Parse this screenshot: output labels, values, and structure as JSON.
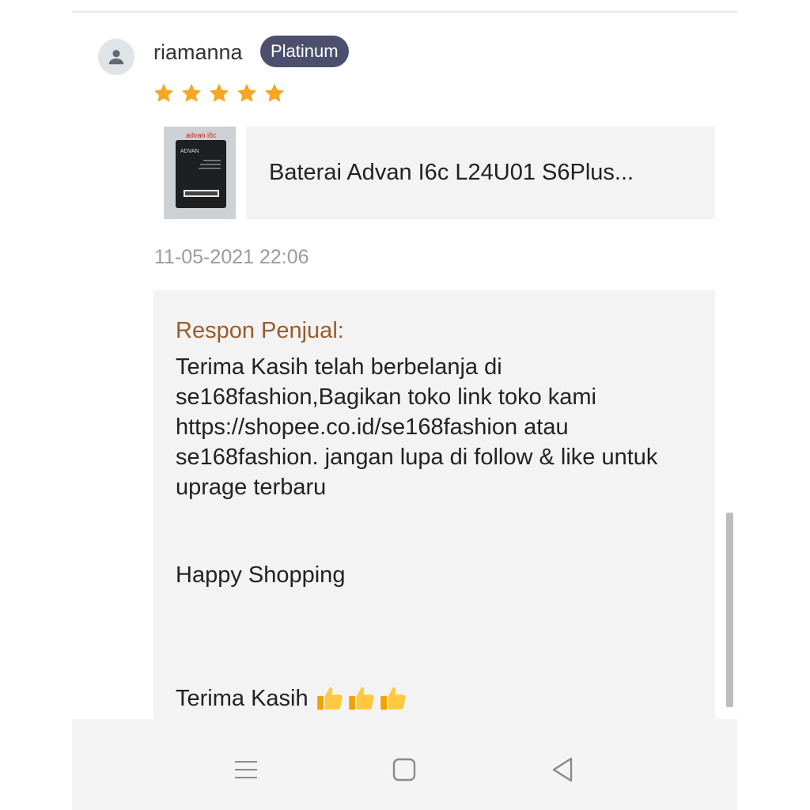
{
  "review": {
    "username": "riamanna",
    "badge": "Platinum",
    "rating": 5,
    "timestamp": "11-05-2021 22:06"
  },
  "product": {
    "title": "Baterai Advan I6c  L24U01 S6Plus...",
    "thumb_caption": "advan i6c",
    "thumb_brand": "ADVAN"
  },
  "seller_response": {
    "label": "Respon Penjual:",
    "body": "Terima Kasih telah berbelanja di se168fashion,Bagikan toko link toko kami https://shopee.co.id/se168fashion atau se168fashion. jangan lupa di follow & like untuk uprage terbaru",
    "happy": "Happy Shopping",
    "thanks": "Terima Kasih"
  },
  "colors": {
    "star": "#f6a623",
    "badge_bg": "#4d4f6e",
    "response_label": "#9a5b2a",
    "response_bg": "#f3f3f3"
  },
  "nav_icons": [
    "menu-icon",
    "home-square-icon",
    "back-triangle-icon"
  ]
}
